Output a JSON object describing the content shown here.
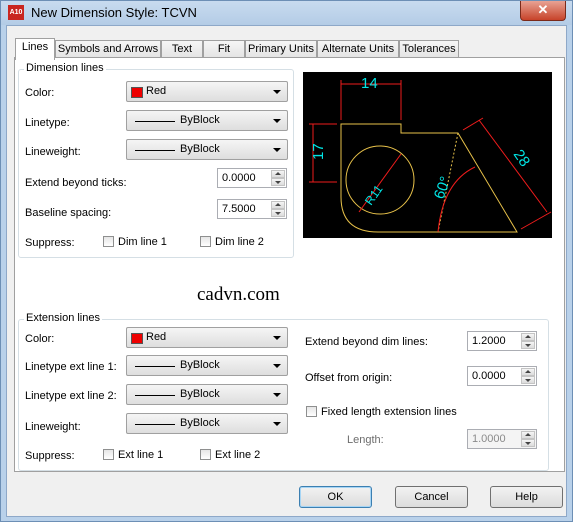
{
  "window": {
    "title": "New Dimension Style: TCVN",
    "app_icon_text": "A10",
    "close_glyph": "✕"
  },
  "tabs": [
    {
      "label": "Lines"
    },
    {
      "label": "Symbols and Arrows"
    },
    {
      "label": "Text"
    },
    {
      "label": "Fit"
    },
    {
      "label": "Primary Units"
    },
    {
      "label": "Alternate Units"
    },
    {
      "label": "Tolerances"
    }
  ],
  "dimension_lines": {
    "title": "Dimension lines",
    "color_label": "Color:",
    "color_value": "Red",
    "linetype_label": "Linetype:",
    "linetype_value": "ByBlock",
    "lineweight_label": "Lineweight:",
    "lineweight_value": "ByBlock",
    "extend_ticks_label": "Extend beyond ticks:",
    "extend_ticks_value": "0.0000",
    "baseline_label": "Baseline spacing:",
    "baseline_value": "7.5000",
    "suppress_label": "Suppress:",
    "dim_line1_label": "Dim line 1",
    "dim_line2_label": "Dim line 2"
  },
  "preview": {
    "dims": {
      "top": "14",
      "left": "17",
      "slant": "28",
      "angle": "60°",
      "radius": "R11"
    },
    "colors": {
      "geometry": "#e8c24a",
      "dimension": "#ee1c1c",
      "text": "#00e5e5"
    }
  },
  "watermark": "cadvn.com",
  "extension_lines": {
    "title": "Extension lines",
    "color_label": "Color:",
    "color_value": "Red",
    "ext1_label": "Linetype ext line 1:",
    "ext1_value": "ByBlock",
    "ext2_label": "Linetype ext line 2:",
    "ext2_value": "ByBlock",
    "lineweight_label": "Lineweight:",
    "lineweight_value": "ByBlock",
    "suppress_label": "Suppress:",
    "ext_line1_label": "Ext line 1",
    "ext_line2_label": "Ext line 2",
    "extend_dim_label": "Extend beyond dim lines:",
    "extend_dim_value": "1.2000",
    "offset_label": "Offset from origin:",
    "offset_value": "0.0000",
    "fixed_length_label": "Fixed length extension lines",
    "length_label": "Length:",
    "length_value": "1.0000"
  },
  "buttons": {
    "ok": "OK",
    "cancel": "Cancel",
    "help": "Help"
  }
}
